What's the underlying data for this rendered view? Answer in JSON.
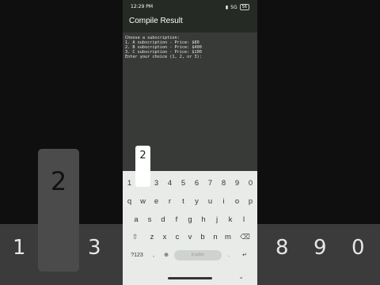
{
  "status_bar": {
    "time": "12:29 PM",
    "network": "5G",
    "battery": "56"
  },
  "app_bar": {
    "title": "Compile Result"
  },
  "console": {
    "lines": [
      "Choose a subscription:",
      "1. A subscription - Price: $80",
      "2. B subscription - Price: $400",
      "3. C subscription - Price: $100",
      "Enter your choice (1, 2, or 3):"
    ]
  },
  "keyboard": {
    "number_row": [
      "1",
      "2",
      "3",
      "4",
      "5",
      "6",
      "7",
      "8",
      "9",
      "0"
    ],
    "row_q": [
      "q",
      "w",
      "e",
      "r",
      "t",
      "y",
      "u",
      "i",
      "o",
      "p"
    ],
    "row_a": [
      "a",
      "s",
      "d",
      "f",
      "g",
      "h",
      "j",
      "k",
      "l"
    ],
    "row_z": [
      "z",
      "x",
      "c",
      "v",
      "b",
      "n",
      "m"
    ],
    "symbols_label": "?123",
    "comma_label": ",",
    "space_label": "English",
    "period_label": ".",
    "enter_glyph": "↵",
    "shift_glyph": "⇧",
    "backspace_glyph": "⌫",
    "globe_glyph": "⊕",
    "toggle_glyph": "⌄",
    "popup_digit": "2"
  },
  "background_zoom": {
    "popup_digit": "2",
    "left_keys": [
      "1",
      "3"
    ],
    "right_keys": [
      "8",
      "9",
      "0"
    ]
  }
}
